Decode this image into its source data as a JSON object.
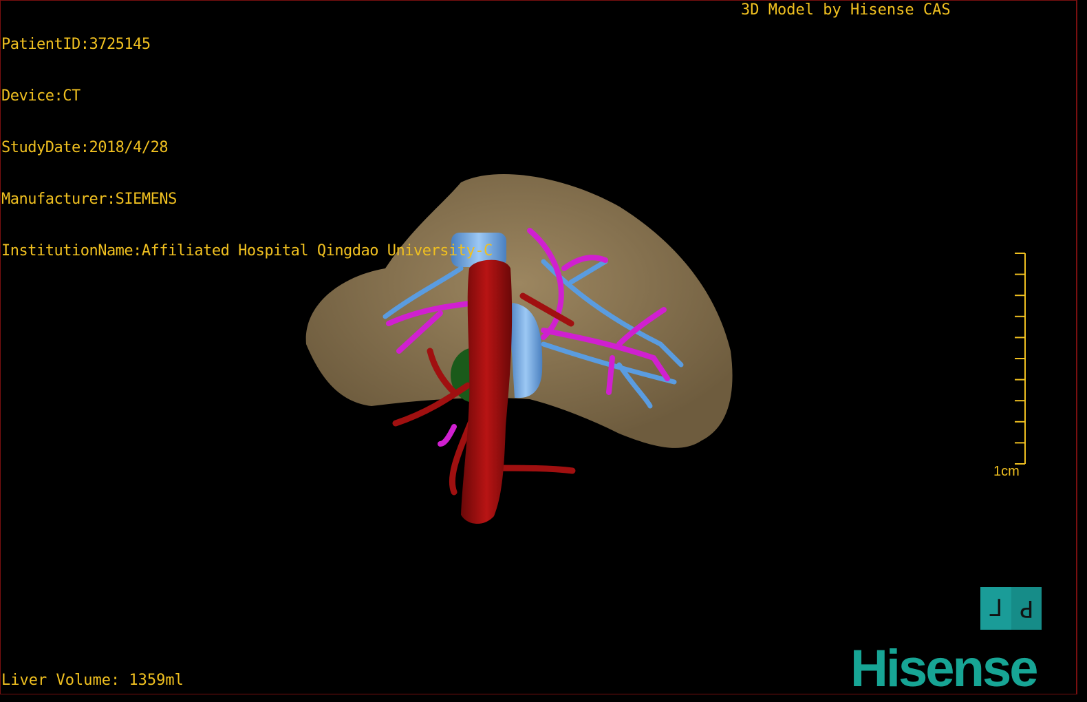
{
  "header": {
    "patient_id": "PatientID:3725145",
    "device": "Device:CT",
    "study_date": "StudyDate:2018/4/28",
    "manufacturer": "Manufacturer:SIEMENS",
    "institution": "InstitutionName:Affiliated Hospital Qingdao University-C",
    "brand_caption": "3D Model by Hisense CAS"
  },
  "footer": {
    "liver_volume": "Liver Volume: 1359ml"
  },
  "scale_bar": {
    "label": "1cm",
    "ticks": 10
  },
  "orientation": {
    "left_label": "L",
    "right_label": "P"
  },
  "logo": {
    "text": "Hisense"
  },
  "colors": {
    "text": "#f0c020",
    "liver": "#8a7450",
    "artery": "#a01010",
    "portal_vein": "#d020d0",
    "hepatic_vein": "#5a9ce0",
    "brand": "#17a595"
  }
}
